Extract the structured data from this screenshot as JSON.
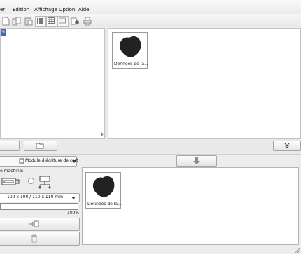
{
  "menu": [
    "er",
    "Edition",
    "Affichage",
    "Option",
    "Aide"
  ],
  "tree": {
    "selected_label": "re"
  },
  "gallery": {
    "items": [
      {
        "label": "Données de la..."
      }
    ]
  },
  "transfer": {
    "module_select": "Module d'écriture de cart",
    "machine_label": "e machine:",
    "hoop_select": "100 x 100 / 110 x 110 mm",
    "progress_text": "100%",
    "progress_value": 1.0,
    "items": [
      {
        "label": "Données de la..."
      }
    ]
  },
  "colors": {
    "accent": "#3a66c4",
    "panel_border": "#c4c4c4"
  },
  "icons": [
    "new-file-icon",
    "open-file-icon",
    "save-icon",
    "thumb-large-icon",
    "thumb-medium-icon",
    "thumb-small-icon",
    "stitch-view-icon",
    "print-icon",
    "folder-icon",
    "collapse-chevrons-icon",
    "arrow-down-icon",
    "card-writer-icon",
    "usb-machine-icon",
    "send-icon",
    "trash-icon"
  ]
}
